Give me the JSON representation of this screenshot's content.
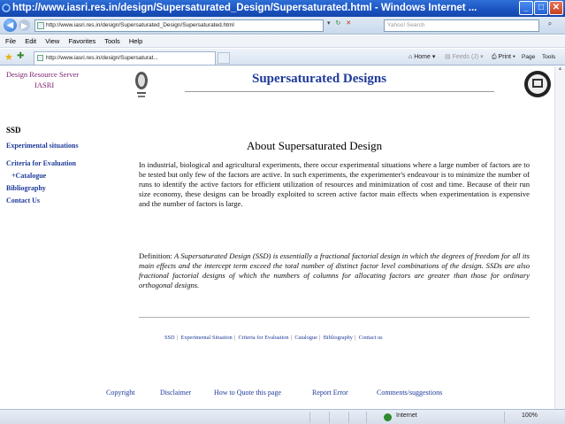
{
  "window": {
    "title": "http://www.iasri.res.in/design/Supersaturated_Design/Supersaturated.html - Windows Internet ...",
    "buttons": [
      "_",
      "□",
      "✕"
    ]
  },
  "addressbar": {
    "url": "http://www.iasri.res.in/design/Supersaturated_Design/Supersaturated.html",
    "search_placeholder": "Yahoo! Search"
  },
  "menu": [
    "File",
    "Edit",
    "View",
    "Favorites",
    "Tools",
    "Help"
  ],
  "tab": {
    "label": "http://www.iasri.res.in/design/Supersaturat..."
  },
  "commands": {
    "home": "Home",
    "feeds": "Feeds (J)",
    "print": "Print",
    "page": "Page",
    "tools": "Tools"
  },
  "sidebar": {
    "org_line1": "Design Resource Server",
    "org_line2": "IASRI",
    "section": "SSD",
    "links": [
      "Experimental situations",
      "Criteria for Evaluation",
      "+Catalogue",
      "Bibliography",
      "Contact Us"
    ]
  },
  "header": {
    "title": "Supersaturated Designs"
  },
  "main": {
    "heading": "About Supersaturated Design",
    "paragraph": "In industrial, biological and agricultural experiments, there occur experimental situations where a large number of factors are to be tested but only few of the factors are active. In such experiments, the experimenter's endeavour is to minimize the number of runs to identify the active factors for efficient utilization of resources and minimization of cost and time. Because of their run size economy, these designs can be broadly exploited to screen active factor main effects when experimentation is expensive and the number of factors is large.",
    "definition_label": "Definition:",
    "definition_text": "A Supersaturated Design (SSD) is essentially a fractional factorial design in which the degrees of freedom for all its main effects and the intercept term exceed the total number of distinct factor level combinations of the design. SSDs are also fractional factorial designs of which the numbers of columns for allocating factors are greater than those for ordinary orthogonal designs."
  },
  "footer_nav": [
    "SSD",
    "Experimental Situation",
    "Criteria for Evaluation",
    "Catalogue",
    "Bibliography",
    "Contact us"
  ],
  "bottom_links": [
    "Copyright",
    "Disclaimer",
    "How to Quote this page",
    "Report Error",
    "Comments/suggestions"
  ],
  "status": {
    "zone": "Internet",
    "zoom": "100%"
  },
  "colors": {
    "link": "#1e3a9a",
    "org": "#7a1b6e",
    "titlebar": "#1a52c0"
  }
}
